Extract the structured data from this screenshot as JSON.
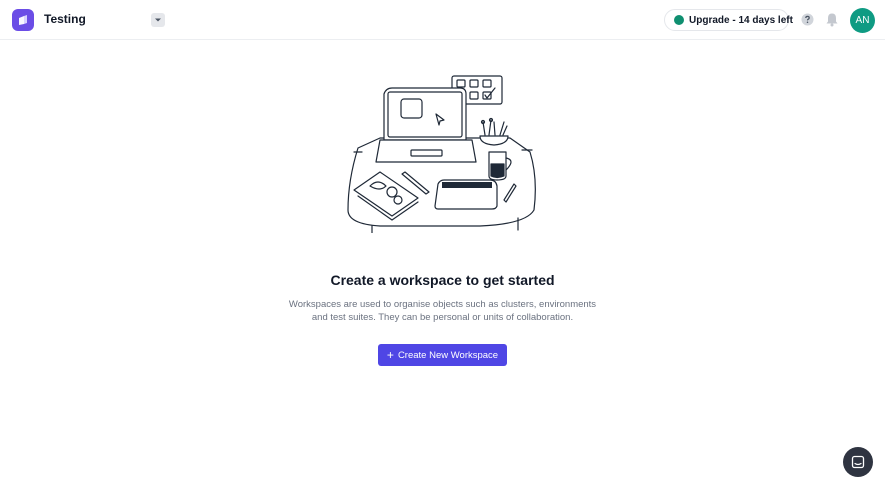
{
  "header": {
    "workspace_name": "Testing",
    "upgrade_label": "Upgrade - 14 days left",
    "avatar_initials": "AN"
  },
  "icons": {
    "logo": "app-logo-icon",
    "dropdown": "chevron-down-icon",
    "upgrade_status": "status-dot-icon",
    "help": "help-icon",
    "notifications": "bell-icon",
    "chat": "chat-icon",
    "create": "plus-icon"
  },
  "empty_state": {
    "title": "Create a workspace to get started",
    "description": "Workspaces are used to organise objects such as clusters, environments and test suites. They can be personal or units of collaboration.",
    "button_icon": "+",
    "button_label": "Create New Workspace"
  },
  "colors": {
    "brand": "#6b4de6",
    "primary_button": "#4f46e5",
    "status_dot": "#0f8f70",
    "avatar": "#0f9b83",
    "chat_button": "#2f3441"
  }
}
